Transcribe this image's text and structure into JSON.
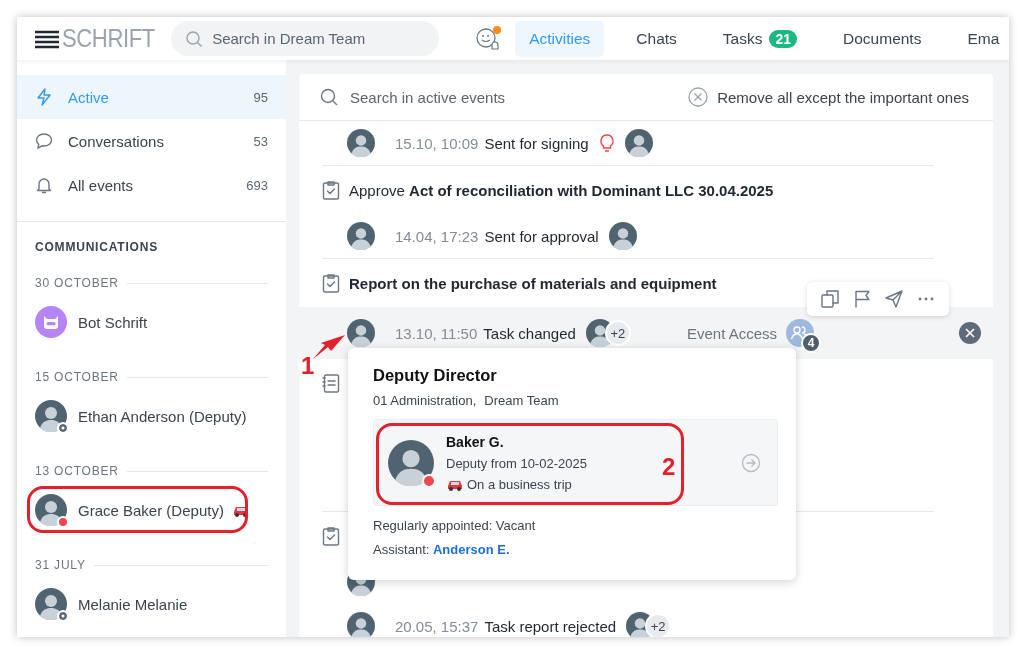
{
  "header": {
    "logo": "SCHRIFT",
    "search": {
      "placeholder": "Search in Dream Team"
    },
    "notification": true,
    "tabs": [
      {
        "label": "Activities",
        "selected": true
      },
      {
        "label": "Chats",
        "selected": false
      },
      {
        "label": "Tasks",
        "selected": false,
        "badge": "21"
      },
      {
        "label": "Documents",
        "selected": false
      },
      {
        "label": "Ema",
        "selected": false
      }
    ]
  },
  "sidebar": {
    "nav": [
      {
        "label": "Active",
        "count": "95",
        "selected": true
      },
      {
        "label": "Conversations",
        "count": "53",
        "selected": false
      },
      {
        "label": "All events",
        "count": "693",
        "selected": false
      }
    ],
    "section": "COMMUNICATIONS",
    "contacts": [
      {
        "date": "30 OCTOBER",
        "name": "Bot Schrift",
        "kind": "bot",
        "busy": false,
        "on_trip": false
      },
      {
        "date": "15 OCTOBER",
        "name": "Ethan Anderson (Deputy)",
        "kind": "person",
        "busy": false,
        "on_trip": false
      },
      {
        "date": "13 OCTOBER",
        "name": "Grace Baker (Deputy)",
        "kind": "person",
        "busy": true,
        "on_trip": true
      },
      {
        "date": "31 JULY",
        "name": "Melanie Melanie",
        "kind": "person",
        "busy": false,
        "on_trip": false
      }
    ]
  },
  "feed": {
    "search": {
      "placeholder": "Search in active events"
    },
    "clear_action": "Remove all except the important ones",
    "groups": [
      {
        "events": [
          {
            "time": "15.10, 10:09",
            "action": "Sent for signing",
            "important": true,
            "selected": false
          }
        ]
      },
      {
        "kind": "task",
        "title": "Approve **Act of reconciliation with Dominant LLC 30.04.2025**",
        "events": [
          {
            "time": "14.04, 17:23",
            "action": "Sent for approval",
            "important": false,
            "selected": false
          }
        ]
      },
      {
        "kind": "task",
        "title": "**Report on the purchase of materials and equipment**",
        "events": [
          {
            "time": "13.10, 11:50",
            "action": "Task changed",
            "others": "+2",
            "important": false,
            "selected": true,
            "access": {
              "label": "Event Access",
              "count": "4"
            }
          }
        ]
      },
      {
        "kind": "document"
      },
      {
        "kind": "task",
        "events": [
          {
            "important": false,
            "selected": false
          },
          {
            "time": "20.05, 15:37",
            "action": "Task report rejected",
            "others": "+2",
            "important": false,
            "selected": false
          }
        ]
      }
    ]
  },
  "popup": {
    "title": "Deputy Director",
    "units": [
      "01 Administration,",
      "Dream Team"
    ],
    "person": {
      "name": "Baker G.",
      "busy": true,
      "deputy": "Deputy from 10-02-2025",
      "note": "On a business trip",
      "on_trip": true
    },
    "appointed": "Regularly appointed: Vacant",
    "assistant_label": "Assistant:",
    "assistant": "Anderson E."
  },
  "annotations": [
    {
      "kind": "outline"
    },
    {
      "kind": "outline"
    },
    {
      "kind": "marker",
      "label": "1"
    },
    {
      "kind": "marker",
      "label": "2"
    }
  ]
}
